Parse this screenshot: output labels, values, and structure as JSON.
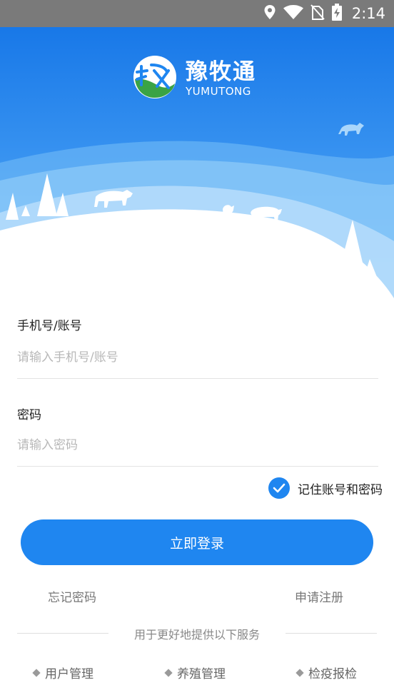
{
  "status_bar": {
    "time": "2:14",
    "icons": [
      "location-icon",
      "wifi-icon",
      "no-sim-icon",
      "battery-charging-icon"
    ]
  },
  "logo": {
    "name_cn": "豫牧通",
    "name_en": "YUMUTONG"
  },
  "form": {
    "account_label": "手机号/账号",
    "account_placeholder": "请输入手机号/账号",
    "account_value": "",
    "password_label": "密码",
    "password_placeholder": "请输入密码",
    "password_value": "",
    "remember_label": "记住账号和密码",
    "remember_checked": true,
    "login_button": "立即登录"
  },
  "links": {
    "forgot_password": "忘记密码",
    "register": "申请注册"
  },
  "services": {
    "title": "用于更好地提供以下服务",
    "items": [
      "用户管理",
      "养殖管理",
      "检疫报检"
    ]
  },
  "colors": {
    "primary": "#1f86f0",
    "status_bar": "#7a7a7a",
    "sky_top": "#1878e8",
    "sky_bottom": "#8ccdf8"
  }
}
